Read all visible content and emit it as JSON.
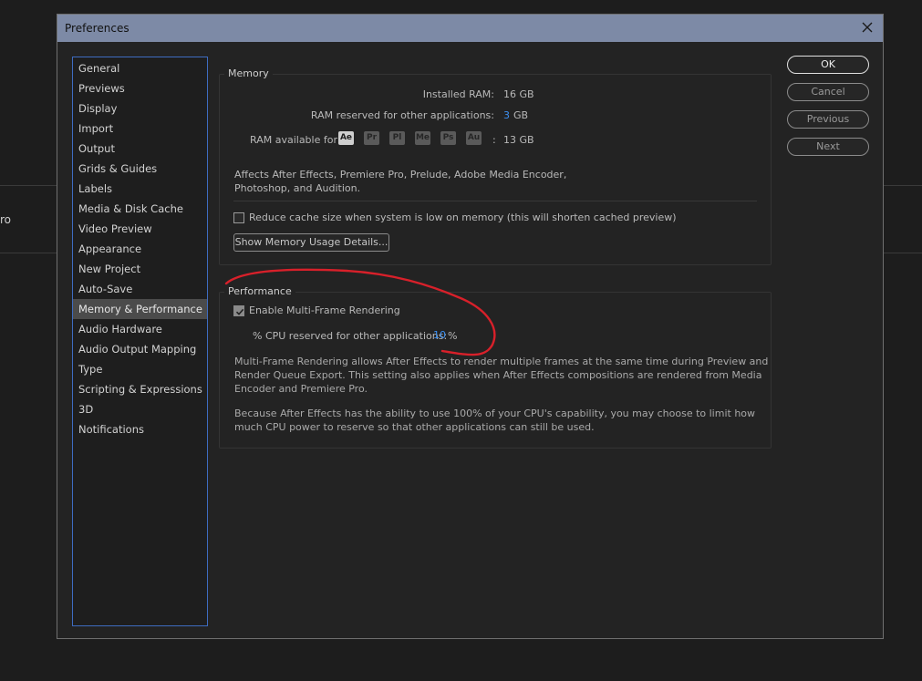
{
  "background": {
    "partial_text": "ro"
  },
  "dialog": {
    "title": "Preferences",
    "close_icon": "close-icon"
  },
  "sidebar": {
    "items": [
      "General",
      "Previews",
      "Display",
      "Import",
      "Output",
      "Grids & Guides",
      "Labels",
      "Media & Disk Cache",
      "Video Preview",
      "Appearance",
      "New Project",
      "Auto-Save",
      "Memory & Performance",
      "Audio Hardware",
      "Audio Output Mapping",
      "Type",
      "Scripting & Expressions",
      "3D",
      "Notifications"
    ],
    "selected": "Memory & Performance"
  },
  "memory": {
    "label": "Memory",
    "installed_ram_label": "Installed RAM:",
    "installed_ram_value": "16 GB",
    "reserved_label": "RAM reserved for other applications:",
    "reserved_value": "3",
    "reserved_unit": "GB",
    "available_label": "RAM available for",
    "apps": [
      "Ae",
      "Pr",
      "Pl",
      "Me",
      "Ps",
      "Au"
    ],
    "available_sep": ":",
    "available_value": "13 GB",
    "note_line1": "Affects After Effects, Premiere Pro, Prelude, Adobe Media Encoder,",
    "note_line2": "Photoshop, and Audition.",
    "reduce_cache_label": "Reduce cache size when system is low on memory (this will shorten cached preview)",
    "reduce_cache_checked": false,
    "show_usage_button": "Show Memory Usage Details..."
  },
  "performance": {
    "label": "Performance",
    "mfr_label": "Enable Multi-Frame Rendering",
    "mfr_checked": true,
    "cpu_label": "% CPU reserved for other applications:",
    "cpu_value": "10",
    "cpu_unit": "%",
    "para1_line1": "Multi-Frame Rendering allows After Effects to render multiple frames at the same time during Preview and",
    "para1_line2": "Render Queue Export. This setting also applies when After Effects compositions are rendered from Media",
    "para1_line3": "Encoder and Premiere Pro.",
    "para2_line1": "Because After Effects has the ability to use 100% of your CPU's capability, you may choose to limit how",
    "para2_line2": "much CPU power to reserve so that other applications can still be used."
  },
  "buttons": {
    "ok": "OK",
    "cancel": "Cancel",
    "previous": "Previous",
    "next": "Next"
  },
  "colors": {
    "accent_blue": "#3c8ff0",
    "annotation_red": "#d8202a",
    "titlebar": "#7d8aa6"
  }
}
